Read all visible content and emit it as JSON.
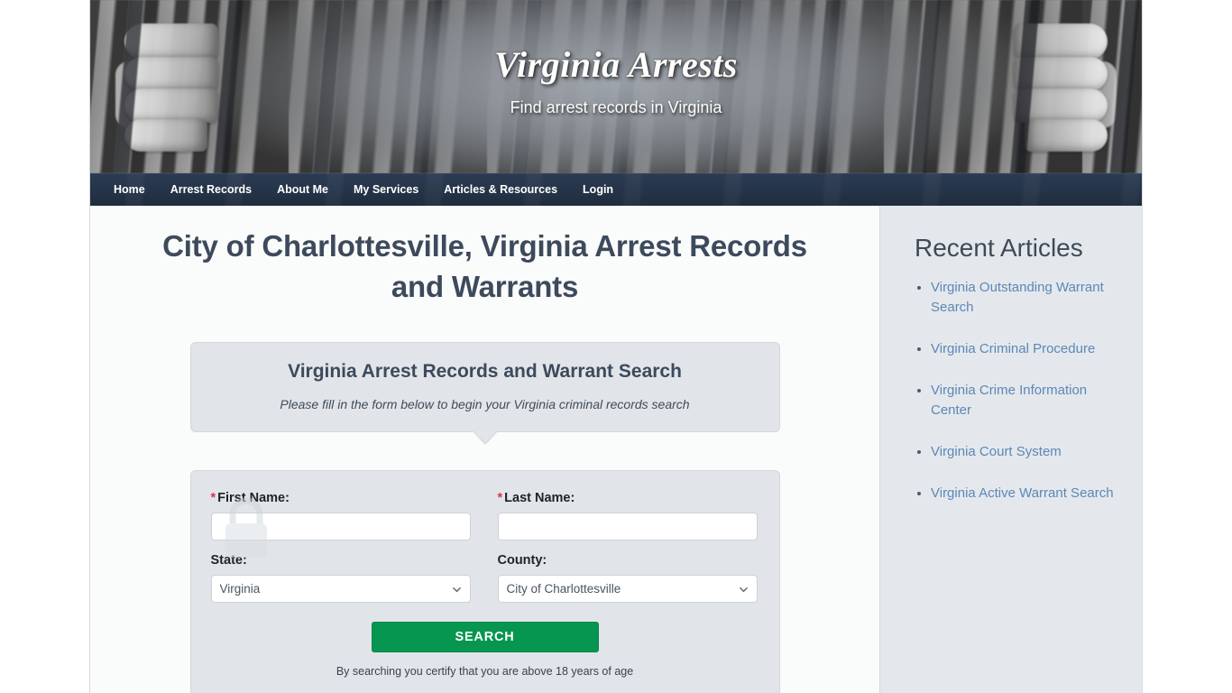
{
  "site": {
    "title": "Virginia Arrests",
    "tagline": "Find arrest records in Virginia"
  },
  "nav": {
    "items": [
      {
        "label": "Home",
        "name": "nav-item-home"
      },
      {
        "label": "Arrest Records",
        "name": "nav-item-arrest-records"
      },
      {
        "label": "About Me",
        "name": "nav-item-about-me"
      },
      {
        "label": "My Services",
        "name": "nav-item-my-services"
      },
      {
        "label": "Articles & Resources",
        "name": "nav-item-articles-resources"
      },
      {
        "label": "Login",
        "name": "nav-item-login"
      }
    ]
  },
  "main": {
    "heading": "City of Charlottesville, Virginia Arrest Records and Warrants",
    "callout": {
      "title": "Virginia Arrest Records and Warrant Search",
      "subtitle": "Please fill in the form below to begin your Virginia criminal records search"
    },
    "form": {
      "required_marker": "*",
      "first_name_label": "First Name:",
      "first_name_value": "",
      "last_name_label": "Last Name:",
      "last_name_value": "",
      "state_label": "State:",
      "state_value": "Virginia",
      "state_options": [
        "Virginia"
      ],
      "county_label": "County:",
      "county_value": "City of Charlottesville",
      "county_options": [
        "City of Charlottesville"
      ],
      "search_button": "SEARCH",
      "disclaimer": "By searching you certify that you are above 18 years of age"
    }
  },
  "sidebar": {
    "title": "Recent Articles",
    "articles": [
      {
        "label": "Virginia Outstanding Warrant Search"
      },
      {
        "label": "Virginia Criminal Procedure"
      },
      {
        "label": "Virginia Crime Information Center"
      },
      {
        "label": "Virginia Court System"
      },
      {
        "label": "Virginia Active Warrant Search"
      }
    ]
  },
  "colors": {
    "nav_bar": "#253448",
    "heading": "#3d4a5c",
    "search_button": "#069650",
    "link": "#5b87b8",
    "required": "#d8344a",
    "panel": "#e1e5e9",
    "sidebar_bg": "#e4e8ec"
  }
}
